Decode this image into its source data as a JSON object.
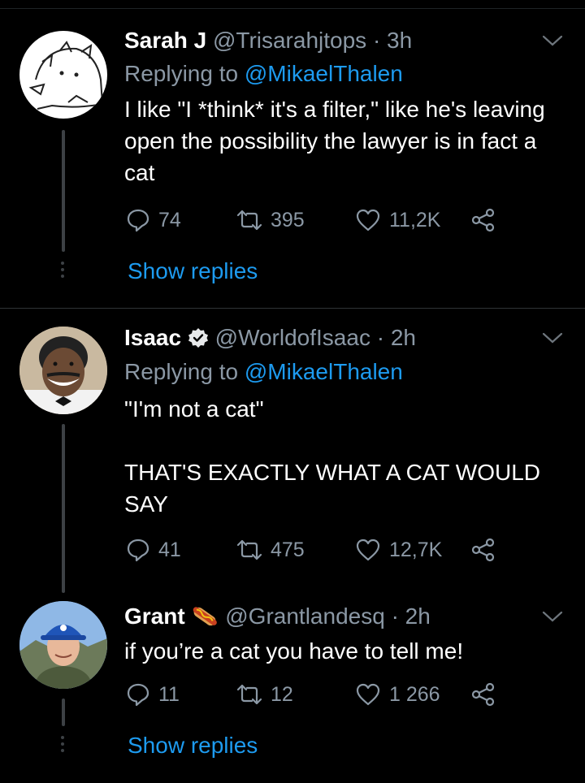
{
  "tweets": [
    {
      "name": "Sarah J",
      "handle": "@Trisarahjtops",
      "time": "· 3h",
      "replying_prefix": "Replying to",
      "replying_to": "@MikaelThalen",
      "text": "I like \"I *think* it's a filter,\" like he's leaving open the possibility the lawyer is in fact a cat",
      "replies": "74",
      "retweets": "395",
      "likes": "11,2K",
      "show_replies": "Show replies"
    },
    {
      "name": "Isaac",
      "handle": "@WorldofIsaac",
      "time": "· 2h",
      "replying_prefix": "Replying to",
      "replying_to": "@MikaelThalen",
      "text": "\"I'm not a cat\"\n\nTHAT'S EXACTLY WHAT A CAT WOULD SAY",
      "replies": "41",
      "retweets": "475",
      "likes": "12,7K"
    },
    {
      "name": "Grant",
      "handle": "@Grantlandesq",
      "time": "· 2h",
      "text": "if you’re a cat you have to tell me!",
      "replies": "11",
      "retweets": "12",
      "likes": "1 266",
      "show_replies": "Show replies"
    }
  ],
  "icons": {
    "reply": "reply-bubble-icon",
    "retweet": "retweet-icon",
    "like": "heart-icon",
    "share": "share-icon",
    "verified": "verified-badge-icon",
    "emoji": "hot-dog-emoji",
    "caret": "chevron-down-icon"
  },
  "colors": {
    "background": "#000000",
    "text": "#ffffff",
    "secondary": "#8b98a5",
    "link": "#1d9bf0"
  }
}
